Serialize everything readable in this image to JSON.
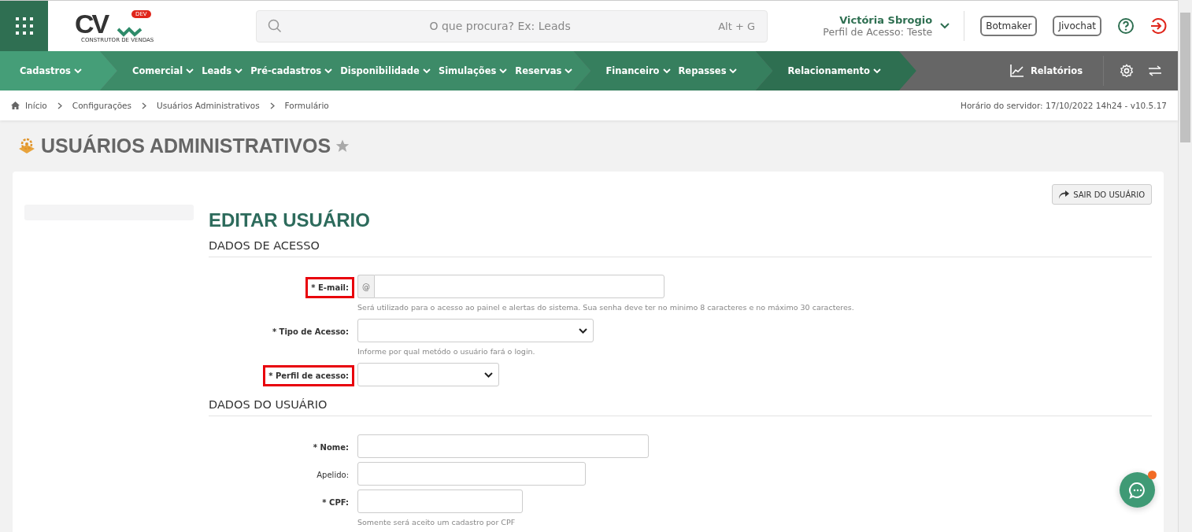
{
  "header": {
    "logo_text": "CV",
    "logo_badge": "DEV",
    "logo_tagline": "CONSTRUTOR DE VENDAS",
    "search": {
      "placeholder": "O que procura? Ex: Leads",
      "shortcut": "Alt + G"
    },
    "user": {
      "name": "Victória Sbrogio",
      "profile": "Perfil de Acesso: Teste"
    },
    "buttons": [
      "Botmaker",
      "Jivochat"
    ]
  },
  "nav": {
    "groups": [
      {
        "color": "#459e78",
        "items": [
          "Cadastros"
        ]
      },
      {
        "color": "#3d8b68",
        "items": [
          "Comercial",
          "Leads",
          "Pré-cadastros",
          "Disponibilidade",
          "Simulações",
          "Reservas"
        ]
      },
      {
        "color": "#367f5e",
        "items": [
          "Financeiro",
          "Repasses"
        ]
      },
      {
        "color": "#2e6f51",
        "items": [
          "Relacionamento"
        ]
      }
    ],
    "reports": "Relatórios"
  },
  "breadcrumb": [
    "Início",
    "Configurações",
    "Usuários Administrativos",
    "Formulário"
  ],
  "server_time": "Horário do servidor: 17/10/2022 14h24 - v10.5.17",
  "page_title": "USUÁRIOS ADMINISTRATIVOS",
  "exit_button": "SAIR DO USUÁRIO",
  "form_title": "EDITAR USUÁRIO",
  "sections": [
    {
      "title": "DADOS DE ACESSO",
      "fields": [
        {
          "kind": "prefix",
          "label": "* E-mail:",
          "required": true,
          "highlighted": true,
          "prefix": "@",
          "help": "Será utilizado para o acesso ao painel e alertas do sistema. Sua senha deve ter no minimo 8 caracteres e no máximo 30 caracteres."
        },
        {
          "kind": "select",
          "label": "* Tipo de Acesso:",
          "required": true,
          "highlighted": false,
          "help": "Informe por qual metódo o usuário fará o login."
        },
        {
          "kind": "select",
          "label": "* Perfil de acesso:",
          "required": true,
          "highlighted": true
        }
      ]
    },
    {
      "title": "DADOS DO USUÁRIO",
      "fields": [
        {
          "kind": "text",
          "label": "* Nome:",
          "required": true,
          "highlighted": false
        },
        {
          "kind": "text",
          "label": "Apelido:",
          "required": false,
          "highlighted": false
        },
        {
          "kind": "text",
          "label": "* CPF:",
          "required": true,
          "highlighted": false,
          "help": "Somente será aceito um cadastro por CPF"
        }
      ]
    }
  ]
}
